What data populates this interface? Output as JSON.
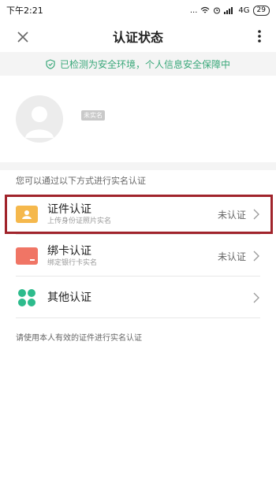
{
  "status_bar": {
    "time": "下午2:21",
    "signal_text": "...",
    "network": "4G",
    "battery": "29"
  },
  "nav": {
    "title": "认证状态"
  },
  "notice": {
    "text": "已检测为安全环境，个人信息安全保障中"
  },
  "profile": {
    "tag": "未实名"
  },
  "section": {
    "subtitle": "您可以通过以下方式进行实名认证"
  },
  "methods": [
    {
      "title": "证件认证",
      "desc": "上传身份证照片实名",
      "status": "未认证",
      "icon": "id-card-icon",
      "color": "#f5b84c"
    },
    {
      "title": "绑卡认证",
      "desc": "绑定银行卡实名",
      "status": "未认证",
      "icon": "bank-card-icon",
      "color": "#f07565"
    },
    {
      "title": "其他认证",
      "desc": "",
      "status": "",
      "icon": "dots-icon",
      "color": "#2dbb8c"
    }
  ],
  "footer": {
    "note": "请使用本人有效的证件进行实名认证"
  },
  "colors": {
    "accent_green": "#3aa87a",
    "highlight_red": "#a0232b"
  }
}
